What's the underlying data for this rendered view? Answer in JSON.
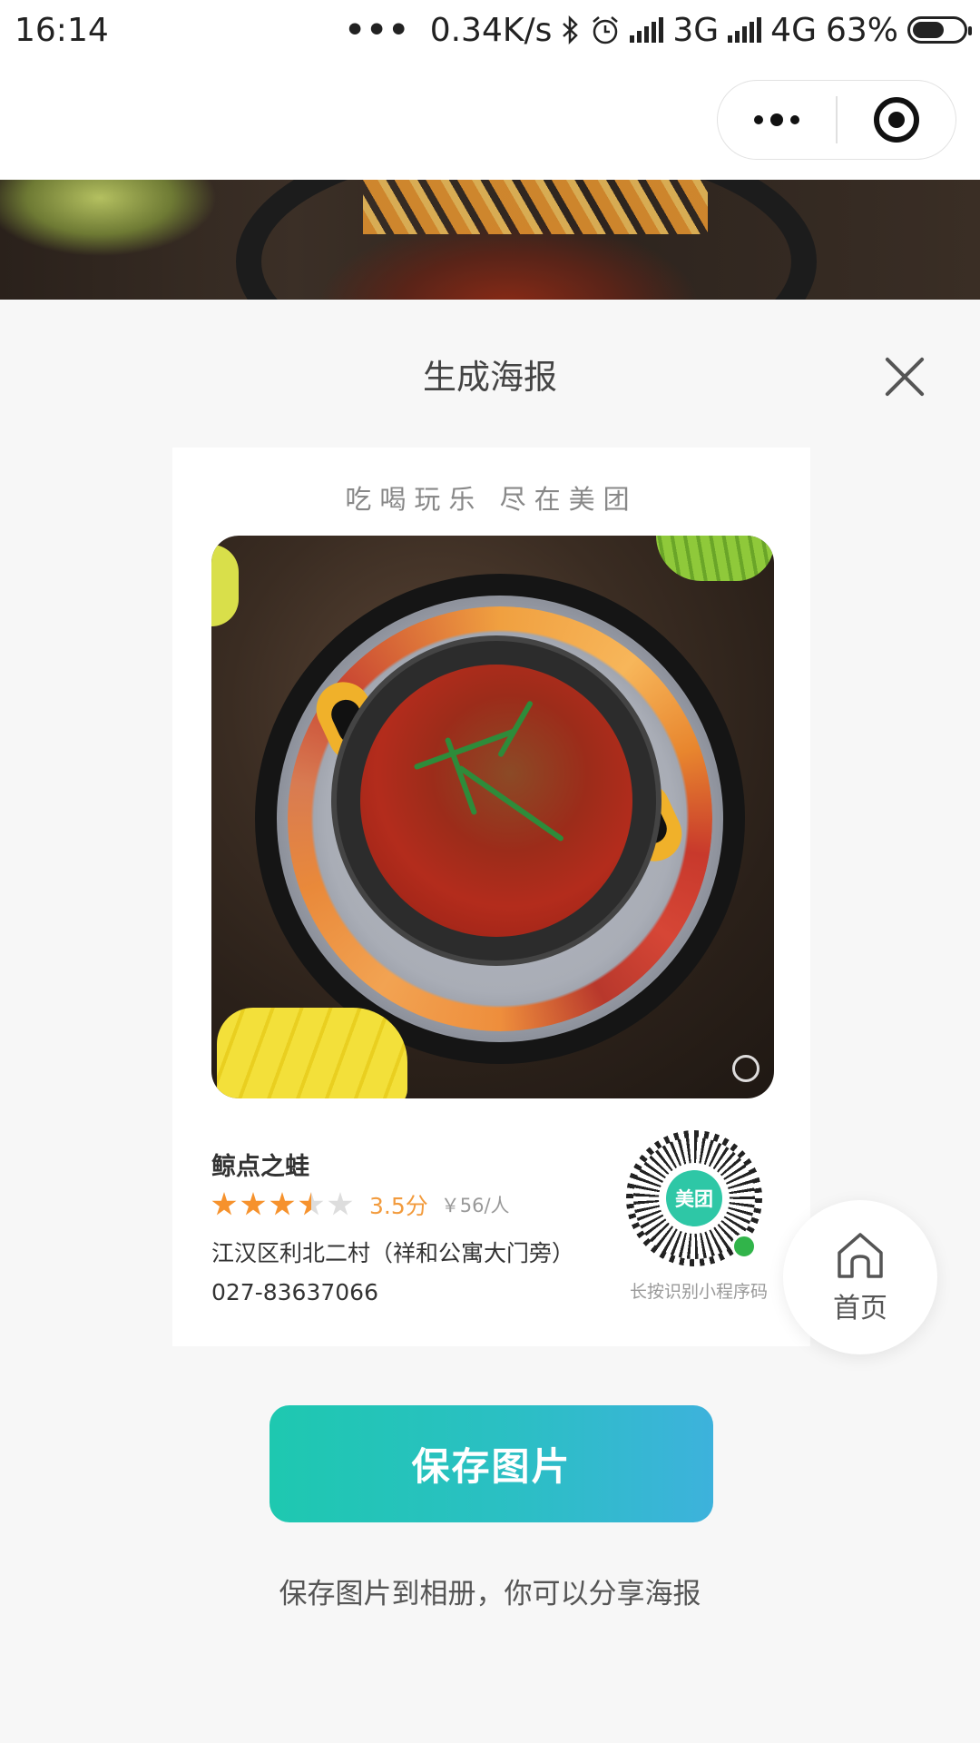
{
  "status_bar": {
    "time": "16:14",
    "dots": "•••",
    "speed": "0.34K/s",
    "bluetooth_icon": "bluetooth-icon",
    "alarm_icon": "alarm-icon",
    "network1": "3G",
    "network2": "4G",
    "battery": "63%"
  },
  "capsule": {
    "more_icon": "more-icon",
    "close_program_icon": "target-icon"
  },
  "sheet": {
    "title": "生成海报",
    "close_icon": "close-icon"
  },
  "poster": {
    "slogan": "吃喝玩乐 尽在美团",
    "shop_name": "鲸点之蛙",
    "rating": 3.5,
    "score": "3.5分",
    "price": "￥56/人",
    "address": "江汉区利北二村（祥和公寓大门旁）",
    "phone": "027-83637066",
    "qr_logo": "美团",
    "qr_caption": "长按识别小程序码"
  },
  "home": {
    "icon": "home-icon",
    "label": "首页"
  },
  "save_button": "保存图片",
  "hint": "保存图片到相册，你可以分享海报",
  "colors": {
    "accent_start": "#1ec8b0",
    "accent_end": "#3db2dc",
    "star": "#f6922d",
    "score": "#f29b3d",
    "meituan": "#2ec7a6"
  }
}
